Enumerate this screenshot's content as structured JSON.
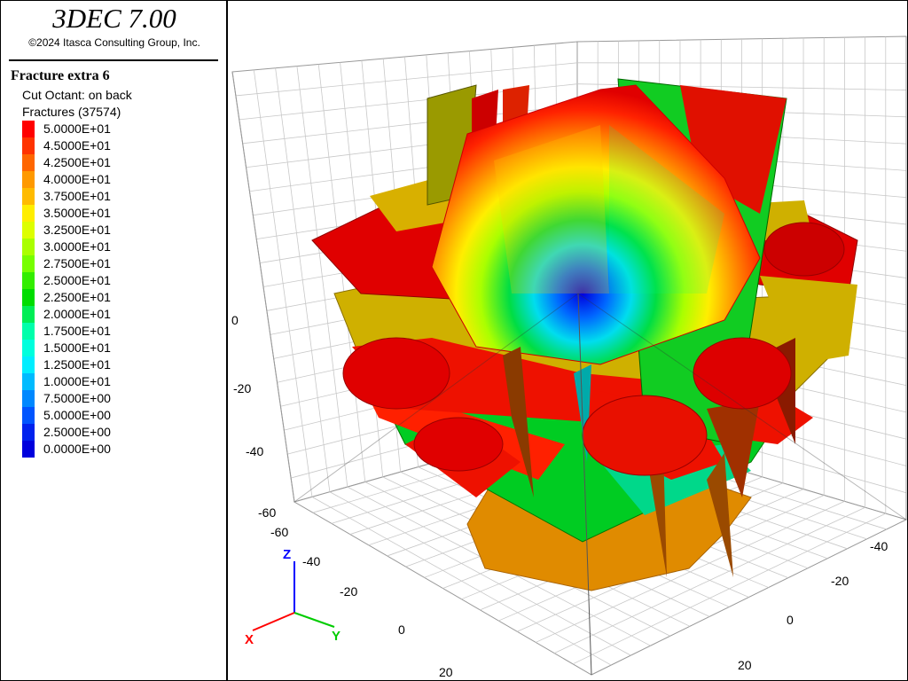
{
  "header": {
    "app_title": "3DEC 7.00",
    "copyright": "©2024 Itasca Consulting Group, Inc."
  },
  "legend": {
    "plot_title": "Fracture extra 6",
    "cut_octant": "Cut Octant: on back",
    "fractures": "Fractures (37574)",
    "colorbar": [
      {
        "label": "5.0000E+01",
        "color": "#ff0000"
      },
      {
        "label": "4.5000E+01",
        "color": "#ff3300"
      },
      {
        "label": "4.2500E+01",
        "color": "#ff6600"
      },
      {
        "label": "4.0000E+01",
        "color": "#ff9900"
      },
      {
        "label": "3.7500E+01",
        "color": "#ffbb00"
      },
      {
        "label": "3.5000E+01",
        "color": "#ffee00"
      },
      {
        "label": "3.2500E+01",
        "color": "#ddff00"
      },
      {
        "label": "3.0000E+01",
        "color": "#aaff00"
      },
      {
        "label": "2.7500E+01",
        "color": "#77ff00"
      },
      {
        "label": "2.5000E+01",
        "color": "#33ee00"
      },
      {
        "label": "2.2500E+01",
        "color": "#00dd00"
      },
      {
        "label": "2.0000E+01",
        "color": "#00ee55"
      },
      {
        "label": "1.7500E+01",
        "color": "#00ffaa"
      },
      {
        "label": "1.5000E+01",
        "color": "#00ffdd"
      },
      {
        "label": "1.2500E+01",
        "color": "#00eeff"
      },
      {
        "label": "1.0000E+01",
        "color": "#00bbff"
      },
      {
        "label": "7.5000E+00",
        "color": "#0088ff"
      },
      {
        "label": "5.0000E+00",
        "color": "#0055ff"
      },
      {
        "label": "2.5000E+00",
        "color": "#0022ee"
      },
      {
        "label": "0.0000E+00",
        "color": "#0000dd"
      }
    ]
  },
  "axes": {
    "z_ticks": [
      "0",
      "-20",
      "-40",
      "-60"
    ],
    "x_ticks": [
      "-60",
      "-40",
      "-20",
      "0",
      "20"
    ],
    "y_ticks": [
      "-40",
      "-20",
      "0",
      "20"
    ],
    "triad": {
      "z": "Z",
      "x": "X",
      "y": "Y"
    }
  },
  "colors": {
    "x_axis": "#ff0000",
    "y_axis": "#00cc00",
    "z_axis": "#0000ff"
  }
}
